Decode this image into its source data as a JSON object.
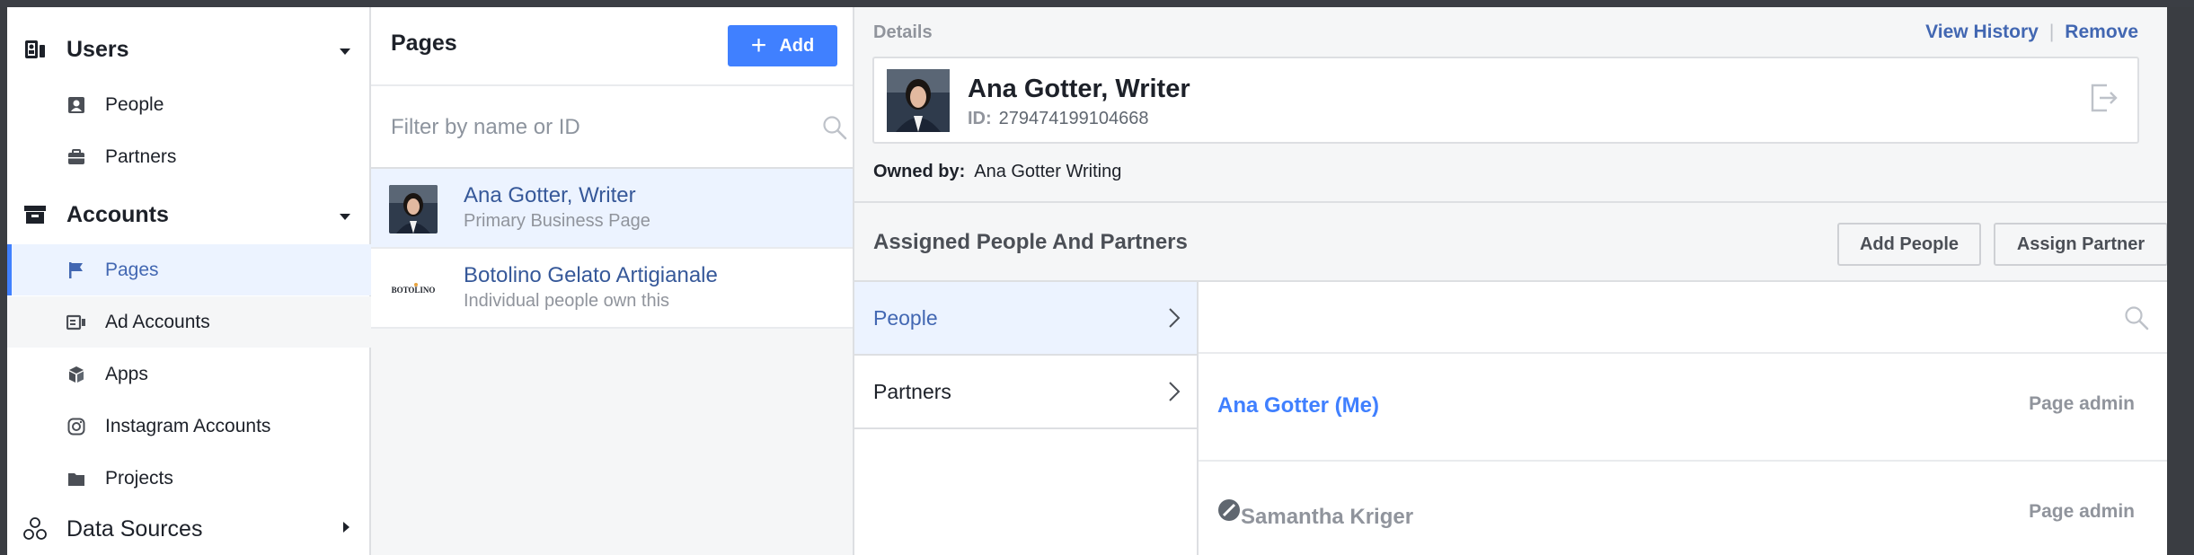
{
  "colors": {
    "accent": "#4080ff",
    "link": "#4267b2",
    "selected_bg": "#ecf3ff",
    "muted": "#90949c"
  },
  "sidebar": {
    "sections": [
      {
        "label": "Users",
        "icon": "users-icon",
        "expanded": true
      },
      {
        "label": "Accounts",
        "icon": "briefcase-icon",
        "expanded": true
      },
      {
        "label": "Data Sources",
        "icon": "data-sources-icon",
        "expanded": false
      }
    ],
    "user_items": [
      {
        "label": "People",
        "icon": "person-card-icon"
      },
      {
        "label": "Partners",
        "icon": "briefcase-small-icon"
      }
    ],
    "account_items": [
      {
        "label": "Pages",
        "icon": "flag-icon",
        "active": true
      },
      {
        "label": "Ad Accounts",
        "icon": "ad-account-icon"
      },
      {
        "label": "Apps",
        "icon": "cube-icon"
      },
      {
        "label": "Instagram Accounts",
        "icon": "instagram-icon"
      },
      {
        "label": "Projects",
        "icon": "folder-icon"
      }
    ]
  },
  "pages_panel": {
    "title": "Pages",
    "add_label": "Add",
    "filter_placeholder": "Filter by name or ID",
    "items": [
      {
        "name": "Ana Gotter, Writer",
        "subtitle": "Primary Business Page",
        "selected": true
      },
      {
        "name": "Botolino Gelato Artigianale",
        "subtitle": "Individual people own this",
        "selected": false,
        "logo_text": "BOTOLINO"
      }
    ]
  },
  "details": {
    "section_label": "Details",
    "view_history_label": "View History",
    "separator": "|",
    "remove_label": "Remove",
    "page_name": "Ana Gotter, Writer",
    "id_label": "ID:",
    "id_value": "279474199104668",
    "owned_by_label": "Owned by:",
    "owned_by_value": "Ana Gotter Writing",
    "assigned_title": "Assigned People And Partners",
    "add_people_label": "Add People",
    "assign_partner_label": "Assign Partner",
    "tabs": [
      {
        "label": "People",
        "active": true
      },
      {
        "label": "Partners",
        "active": false
      }
    ],
    "people": [
      {
        "name": "Ana Gotter (Me)",
        "role": "Page admin",
        "color": "#4080ff",
        "has_badge": false
      },
      {
        "name": "Samantha Kriger",
        "role": "Page admin",
        "color": "#90949c",
        "has_badge": true
      }
    ]
  }
}
